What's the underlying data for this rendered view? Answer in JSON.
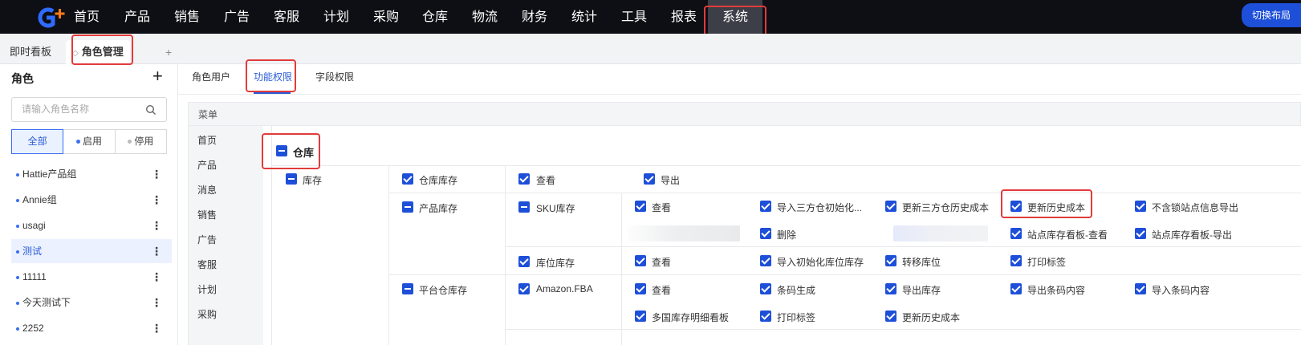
{
  "app": {
    "logo": "G+",
    "nav": [
      "首页",
      "产品",
      "销售",
      "广告",
      "客服",
      "计划",
      "采购",
      "仓库",
      "物流",
      "财务",
      "统计",
      "工具",
      "报表",
      "系统"
    ],
    "active_nav": "系统",
    "layout_button": "切换布局"
  },
  "tabs": {
    "items": [
      "即时看板",
      "角色管理"
    ],
    "active": "角色管理",
    "add": "+"
  },
  "sidebar": {
    "title": "角色",
    "add": "+",
    "search_placeholder": "请输入角色名称",
    "filters": [
      "全部",
      "启用",
      "停用"
    ],
    "active_filter": "全部",
    "status_colors": {
      "enabled": "#3a6ff0",
      "disabled": "#bbbbbb"
    },
    "roles": [
      "Hattie产品组",
      "Annie组",
      "usagi",
      "测试",
      "11111",
      "今天测试下",
      "2252"
    ],
    "selected_role": "测试",
    "more": "⋮"
  },
  "content_tabs": {
    "items": [
      "角色用户",
      "功能权限",
      "字段权限"
    ],
    "active": "功能权限"
  },
  "permissions": {
    "menu_header": "菜单",
    "menu_items": [
      "首页",
      "产品",
      "消息",
      "销售",
      "广告",
      "客服",
      "计划",
      "采购"
    ],
    "section": "仓库",
    "group": "库存",
    "rows": {
      "warehouse_stock": {
        "name": "仓库库存",
        "perms": [
          "查看",
          "导出"
        ]
      },
      "product_stock": {
        "name": "产品库存",
        "sku": {
          "name": "SKU库存",
          "perms": [
            "查看",
            "导入三方仓初始化...",
            "更新三方仓历史成本",
            "更新历史成本",
            "不含锁站点信息导出",
            "删除",
            "站点库存看板-查看",
            "站点库存看板-导出"
          ]
        },
        "location": {
          "name": "库位库存",
          "perms": [
            "查看",
            "导入初始化库位库存",
            "转移库位",
            "打印标签"
          ]
        }
      },
      "platform_stock": {
        "name": "平台仓库存",
        "amazon": {
          "name": "Amazon.FBA",
          "perms": [
            "查看",
            "条码生成",
            "导出库存",
            "导出条码内容",
            "导入条码内容",
            "多国库存明细看板",
            "打印标签",
            "更新历史成本"
          ]
        }
      }
    }
  },
  "colors": {
    "accent": "#1e4fd8",
    "highlight": "#e23b3b",
    "topbar": "#0d0f14"
  }
}
